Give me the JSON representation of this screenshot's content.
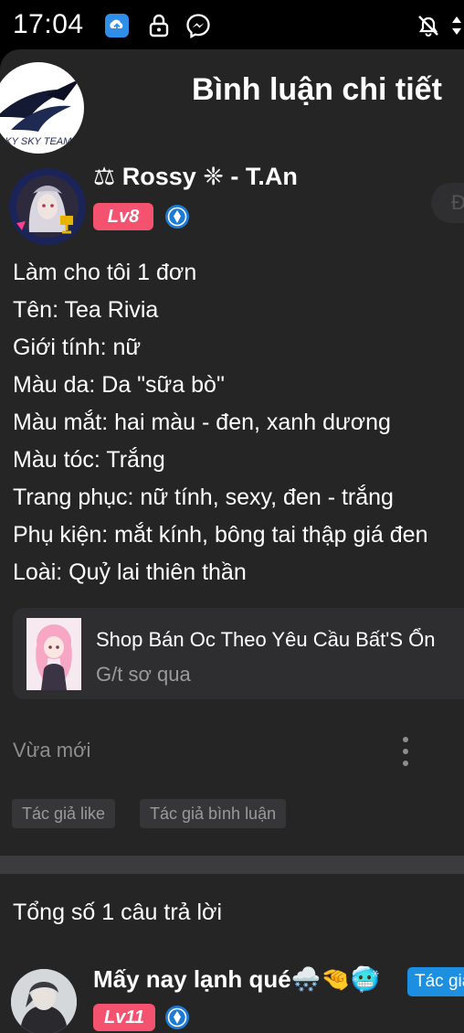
{
  "status_bar": {
    "time": "17:04",
    "icons": [
      "cloud-app-icon",
      "lock-icon",
      "messenger-icon",
      "notifications-off-icon",
      "signal-icon"
    ]
  },
  "header": {
    "title": "Bình luận chi tiết",
    "logo_text": "SKY SKY TEAM",
    "logo_icon": "wings-logo-icon"
  },
  "comment": {
    "author": {
      "name": "⚖ Rossy ❈ - T.An",
      "level": "Lv8",
      "verified_icon": "verified-icon",
      "avatar_icon": "avatar-image"
    },
    "follow_label": "Đ",
    "lines": [
      "Làm cho tôi 1 đơn",
      "Tên: Tea Rivia",
      "Giới tính: nữ",
      "Màu da: Da \"sữa bò\"",
      "Màu mắt: hai màu - đen, xanh dương",
      "Màu tóc: Trắng",
      "Trang phục: nữ tính, sexy, đen - trắng",
      "Phụ kiện: mắt kính, bông tai thập giá đen",
      "Loài: Quỷ lai thiên thần"
    ],
    "link_card": {
      "title": "Shop Bán Oc Theo Yêu Cầu Bất'S Ổn",
      "subtitle": "G/t sơ qua"
    },
    "timestamp": "Vừa mới",
    "tags": [
      "Tác giả like",
      "Tác giả bình luận"
    ]
  },
  "replies": {
    "count_label": "Tổng số 1 câu trả lời",
    "items": [
      {
        "name": "Mấy nay lạnh qué🌨️🤏🥶",
        "level": "Lv11",
        "badge": "Tác giả"
      }
    ]
  },
  "colors": {
    "background": "#252526",
    "level_badge": "#f4526f",
    "author_badge": "#1d8fe1",
    "verified": "#1d7bd6"
  }
}
